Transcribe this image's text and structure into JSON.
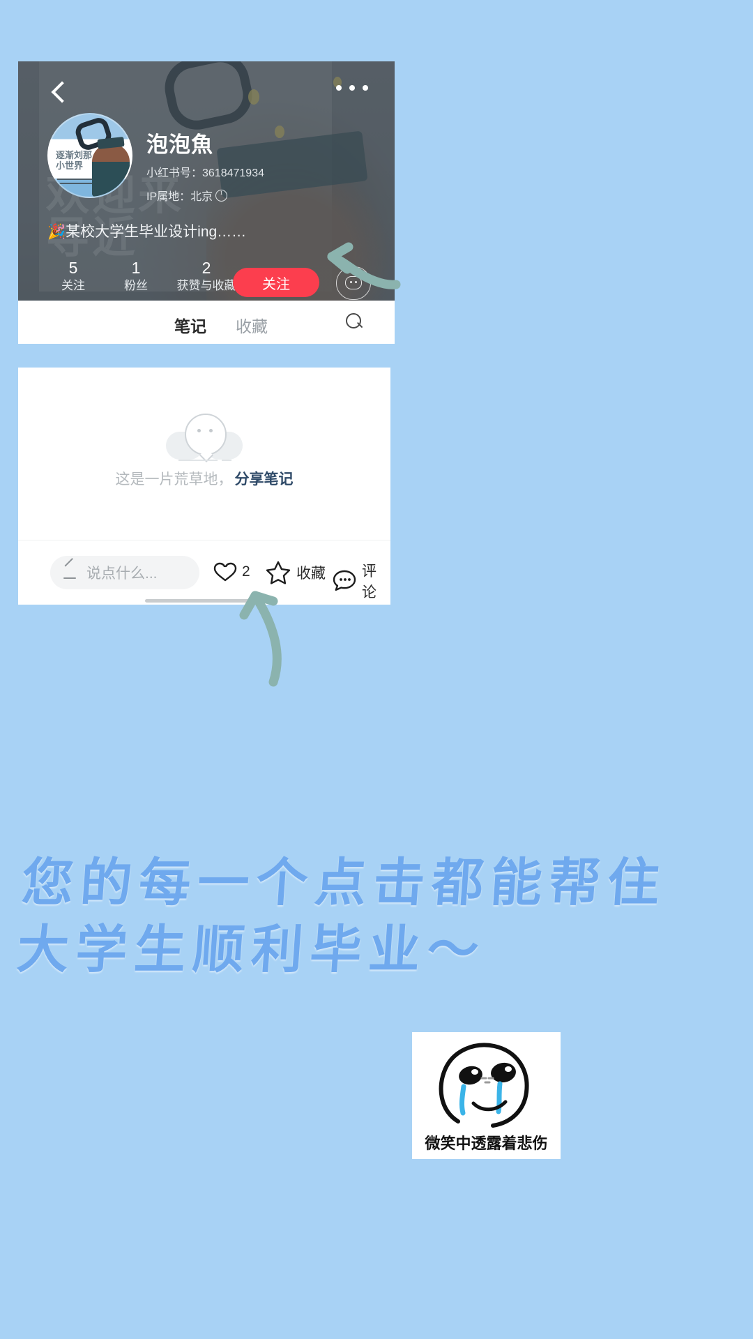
{
  "page": {
    "background_color": "#a8d2f5",
    "accent_red": "#fc3e4e",
    "annotation_color": "#8bb3ae",
    "handwriting_color": "#6fa9ee"
  },
  "profile_card": {
    "back_icon": "back-chevron-icon",
    "more_icon": "more-options-icon",
    "avatar_alt": "avatar",
    "avatar_text": "逐渐刘那\n小世界",
    "username": "泡泡魚",
    "user_id_label": "小红书号：",
    "user_id_value": "3618471934",
    "ip_label": "IP属地：",
    "ip_value": "北京",
    "bio_emoji": "🎉",
    "bio": "某校大学生毕业设计ing……",
    "stats": [
      {
        "value": "5",
        "label": "关注"
      },
      {
        "value": "1",
        "label": "粉丝"
      },
      {
        "value": "2",
        "label": "获赞与收藏"
      }
    ],
    "follow_button": "关注",
    "message_button_icon": "message-bubble-icon",
    "tabs": [
      {
        "label": "笔记",
        "active": true
      },
      {
        "label": "收藏",
        "active": false
      }
    ],
    "search_icon": "search-icon"
  },
  "notes_card": {
    "empty_icon": "empty-bubble-icon",
    "empty_text": "这是一片荒草地，",
    "empty_link": "分享笔记",
    "comment_placeholder": "说点什么...",
    "pencil_icon": "pencil-icon",
    "actions": [
      {
        "icon": "heart-icon",
        "label": "2",
        "name": "like"
      },
      {
        "icon": "star-icon",
        "label": "收藏",
        "name": "favorite"
      },
      {
        "icon": "chat-icon",
        "label": "评论",
        "name": "comment"
      }
    ]
  },
  "annotations": {
    "arrow_to_follow": "arrow-pointing-to-follow-button",
    "arrow_to_like": "arrow-pointing-to-like-button"
  },
  "handwriting": {
    "line1": "您的每一个点击都能帮住",
    "line2": "大学生顺利毕业～"
  },
  "meme": {
    "face_alt": "crying-smiling-face",
    "caption": "微笑中透露着悲伤"
  }
}
